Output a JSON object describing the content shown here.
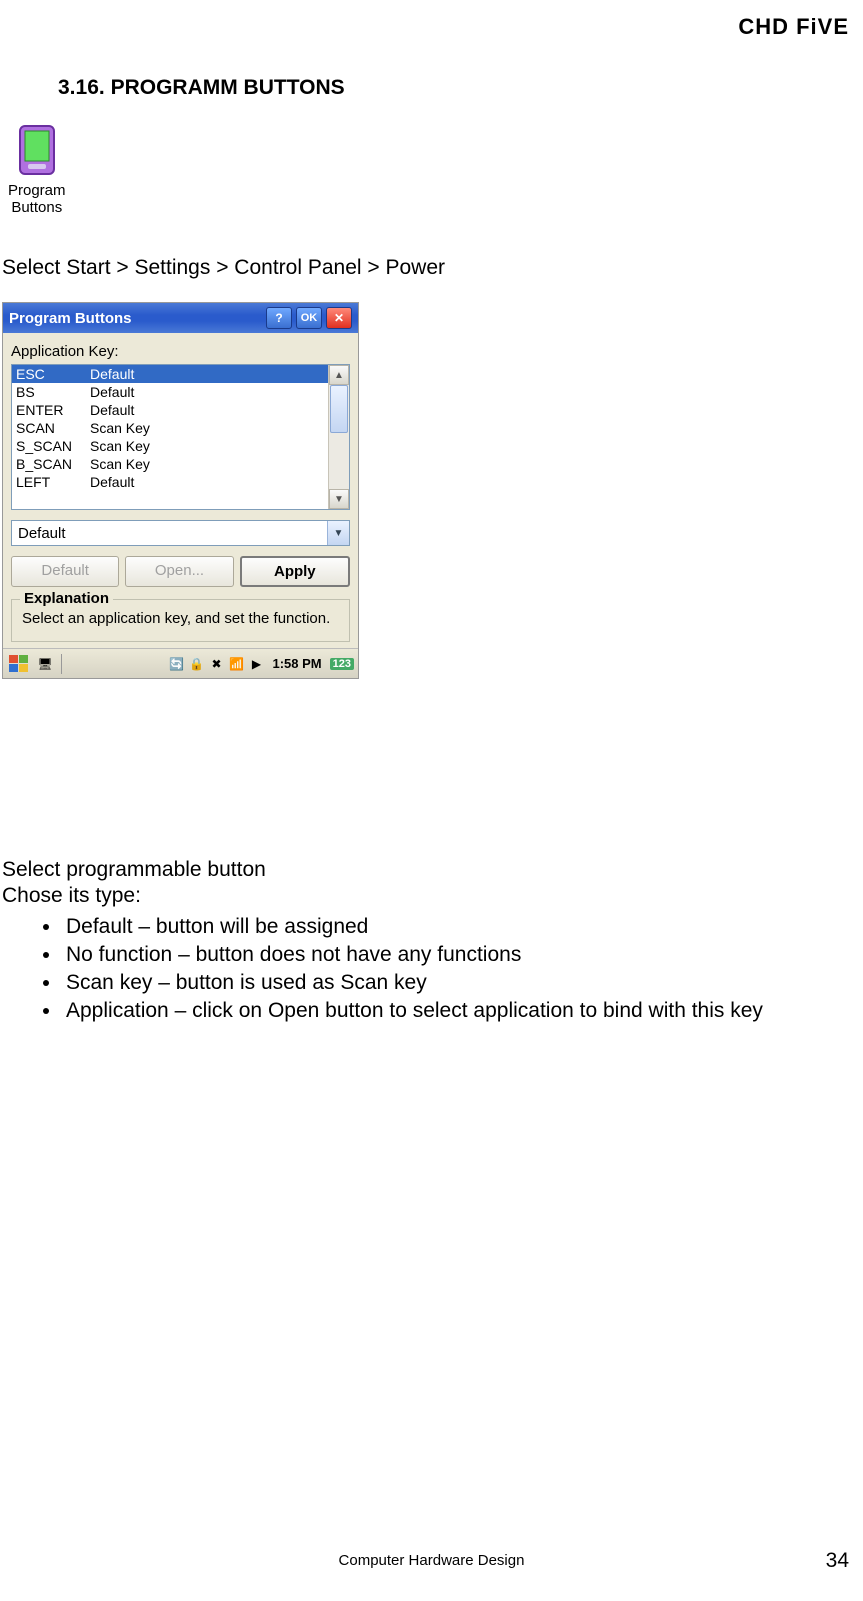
{
  "header": {
    "logo": "CHD FiVE"
  },
  "section": {
    "number": "3.16.",
    "title": "PROGRAMM BUTTONS"
  },
  "icon": {
    "label1": "Program",
    "label2": "Buttons"
  },
  "breadcrumb": "Select Start > Settings > Control Panel > Power",
  "window": {
    "title": "Program Buttons",
    "help": "?",
    "ok": "OK",
    "close": "✕",
    "appKeyLabel": "Application Key:",
    "rows": [
      {
        "key": "ESC",
        "val": "Default",
        "sel": true
      },
      {
        "key": "BS",
        "val": "Default"
      },
      {
        "key": "ENTER",
        "val": "Default"
      },
      {
        "key": "SCAN",
        "val": "Scan Key"
      },
      {
        "key": "S_SCAN",
        "val": "Scan Key"
      },
      {
        "key": "B_SCAN",
        "val": "Scan Key"
      },
      {
        "key": "LEFT",
        "val": "Default"
      }
    ],
    "dropdownValue": "Default",
    "buttons": {
      "default": "Default",
      "open": "Open...",
      "apply": "Apply"
    },
    "group": {
      "legend": "Explanation",
      "text": "Select an application key, and set the function."
    },
    "taskbar": {
      "time": "1:58 PM",
      "kbd": "123"
    }
  },
  "body": {
    "line1": "Select programmable button",
    "line2": "Chose its type:",
    "bullets": [
      "Default – button will be assigned",
      "No function – button does not have any functions",
      "Scan key – button is used as Scan key",
      "Application – click on Open button to select application to bind with this key"
    ]
  },
  "footer": {
    "center": "Computer Hardware Design",
    "page": "34"
  }
}
